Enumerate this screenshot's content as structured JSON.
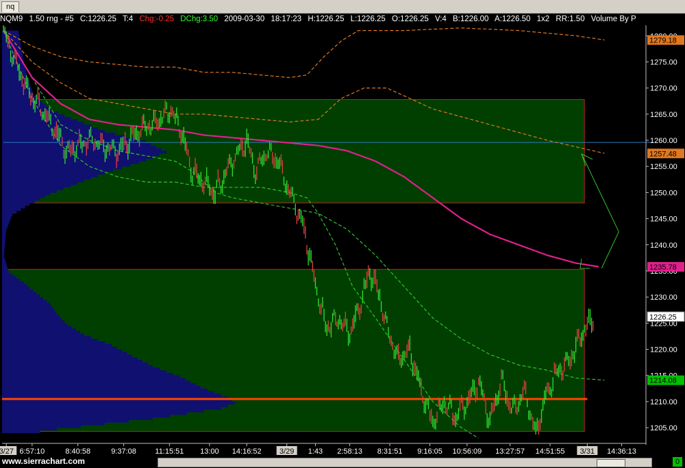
{
  "tab": {
    "label": "nq"
  },
  "header": {
    "symbol": "NQM9",
    "bar_type": "1.50 rng - #5",
    "close": "C:1226.25",
    "ticks": "T:4",
    "chg": "Chg:-0.25",
    "dchg": "DChg:3.50",
    "date": "2009-03-30",
    "time": "18:17:23",
    "high": "H:1226.25",
    "low": "L:1226.25",
    "open": "O:1226.25",
    "volume": "V:4",
    "bid": "B:1226.00",
    "ask": "A:1226.50",
    "size": "1x2",
    "rr": "RR:1.50",
    "study": "Volume By P"
  },
  "footer": {
    "url": "www.sierrachart.com",
    "badge": "0"
  },
  "colors": {
    "background": "#000000",
    "zone": "#003f00",
    "zone_border": "#c02020",
    "profile": "#101070",
    "ma_magenta": "#e0208c",
    "band_orange": "#e07820",
    "band_green": "#30c030",
    "hline_blue": "#2a7cbf",
    "poc_line": "#ff4500",
    "price_up": "#30e030",
    "price_down": "#e04040",
    "arrow": "#30c030"
  },
  "chart_data": {
    "type": "line",
    "title": "",
    "y_axis": {
      "ylim": [
        1202,
        1282
      ],
      "ticks": [
        1280,
        1275,
        1270,
        1265,
        1260,
        1255,
        1250,
        1245,
        1240,
        1235,
        1230,
        1225,
        1220,
        1215,
        1210,
        1205
      ],
      "tick_labels": [
        "1280.00",
        "1275.00",
        "1270.00",
        "1265.00",
        "1260.00",
        "1255.00",
        "1250.00",
        "1245.00",
        "1240.00",
        "1235.00",
        "1230.00",
        "1225.00",
        "1220.00",
        "1215.00",
        "1210.00",
        "1205.00"
      ]
    },
    "x_axis": {
      "ticks": [
        {
          "label": "3/27",
          "bar": 1,
          "is_date": true
        },
        {
          "label": "6:57:10",
          "bar": 10
        },
        {
          "label": "8:40:58",
          "bar": 26
        },
        {
          "label": "9:37:08",
          "bar": 42
        },
        {
          "label": "11:15:51",
          "bar": 58
        },
        {
          "label": "13:00",
          "bar": 72
        },
        {
          "label": "14:16:52",
          "bar": 85
        },
        {
          "label": "3/29",
          "bar": 99,
          "is_date": true
        },
        {
          "label": "1:43",
          "bar": 109
        },
        {
          "label": "2:58:13",
          "bar": 121
        },
        {
          "label": "8:31:51",
          "bar": 135
        },
        {
          "label": "9:16:05",
          "bar": 149
        },
        {
          "label": "10:56:09",
          "bar": 162
        },
        {
          "label": "13:27:57",
          "bar": 177
        },
        {
          "label": "14:51:55",
          "bar": 191
        },
        {
          "label": "3/31",
          "bar": 204,
          "is_date": true
        },
        {
          "label": "14:36:13",
          "bar": 216
        }
      ],
      "bar_count": 225
    },
    "price_series": {
      "name": "NQM9",
      "anchors": [
        [
          0,
          1281
        ],
        [
          4,
          1275
        ],
        [
          8,
          1270
        ],
        [
          12,
          1267
        ],
        [
          18,
          1262
        ],
        [
          22,
          1258
        ],
        [
          30,
          1260
        ],
        [
          40,
          1258
        ],
        [
          48,
          1262
        ],
        [
          55,
          1264
        ],
        [
          58,
          1266
        ],
        [
          62,
          1262
        ],
        [
          66,
          1254
        ],
        [
          70,
          1252
        ],
        [
          74,
          1250
        ],
        [
          80,
          1256
        ],
        [
          85,
          1260
        ],
        [
          88,
          1254
        ],
        [
          92,
          1258
        ],
        [
          96,
          1256
        ],
        [
          100,
          1250
        ],
        [
          104,
          1245
        ],
        [
          107,
          1238
        ],
        [
          110,
          1230
        ],
        [
          113,
          1224
        ],
        [
          117,
          1226
        ],
        [
          121,
          1223
        ],
        [
          125,
          1229
        ],
        [
          128,
          1235
        ],
        [
          131,
          1231
        ],
        [
          134,
          1224
        ],
        [
          138,
          1218
        ],
        [
          142,
          1220
        ],
        [
          146,
          1212
        ],
        [
          150,
          1206
        ],
        [
          154,
          1210
        ],
        [
          158,
          1207
        ],
        [
          162,
          1210
        ],
        [
          166,
          1214
        ],
        [
          170,
          1206
        ],
        [
          174,
          1214
        ],
        [
          178,
          1208
        ],
        [
          182,
          1212
        ],
        [
          186,
          1204
        ],
        [
          190,
          1212
        ],
        [
          194,
          1216
        ],
        [
          198,
          1218
        ],
        [
          202,
          1223
        ],
        [
          206,
          1226.25
        ]
      ]
    },
    "moving_average": {
      "anchors": [
        [
          0,
          1281
        ],
        [
          10,
          1272
        ],
        [
          20,
          1267
        ],
        [
          30,
          1264
        ],
        [
          40,
          1263
        ],
        [
          60,
          1262
        ],
        [
          70,
          1261
        ],
        [
          80,
          1260.5
        ],
        [
          90,
          1260
        ],
        [
          100,
          1259.5
        ],
        [
          110,
          1259
        ],
        [
          120,
          1258
        ],
        [
          130,
          1256
        ],
        [
          140,
          1253
        ],
        [
          150,
          1249
        ],
        [
          160,
          1245
        ],
        [
          170,
          1242
        ],
        [
          180,
          1240
        ],
        [
          190,
          1238
        ],
        [
          200,
          1236.5
        ],
        [
          208,
          1235.8
        ]
      ],
      "last_label": "1235.78"
    },
    "upper_band": {
      "anchors": [
        [
          0,
          1281
        ],
        [
          10,
          1278
        ],
        [
          20,
          1276
        ],
        [
          30,
          1275
        ],
        [
          40,
          1274.5
        ],
        [
          50,
          1274
        ],
        [
          60,
          1274
        ],
        [
          70,
          1273
        ],
        [
          80,
          1273
        ],
        [
          90,
          1272.5
        ],
        [
          100,
          1272
        ],
        [
          106,
          1272.5
        ],
        [
          112,
          1276
        ],
        [
          118,
          1279
        ],
        [
          124,
          1281
        ],
        [
          140,
          1281
        ],
        [
          160,
          1281.5
        ],
        [
          180,
          1281
        ],
        [
          200,
          1280
        ],
        [
          210,
          1279.2
        ]
      ],
      "last_label": "1279.18"
    },
    "upper_inner_band": {
      "anchors": [
        [
          0,
          1281
        ],
        [
          10,
          1275
        ],
        [
          20,
          1271
        ],
        [
          30,
          1268
        ],
        [
          40,
          1267
        ],
        [
          50,
          1266
        ],
        [
          60,
          1265
        ],
        [
          70,
          1265
        ],
        [
          80,
          1264.5
        ],
        [
          90,
          1264
        ],
        [
          100,
          1263.5
        ],
        [
          110,
          1264
        ],
        [
          118,
          1268
        ],
        [
          126,
          1270
        ],
        [
          134,
          1270
        ],
        [
          150,
          1266
        ],
        [
          170,
          1263
        ],
        [
          190,
          1260
        ],
        [
          210,
          1257.5
        ]
      ],
      "last_label": "1257.48"
    },
    "lower_inner_band": {
      "anchors": [
        [
          0,
          1281
        ],
        [
          10,
          1272
        ],
        [
          20,
          1263
        ],
        [
          30,
          1260
        ],
        [
          40,
          1258
        ],
        [
          50,
          1257
        ],
        [
          60,
          1256
        ],
        [
          66,
          1254
        ],
        [
          70,
          1252
        ],
        [
          74,
          1250
        ],
        [
          80,
          1249
        ],
        [
          90,
          1248
        ],
        [
          100,
          1247
        ],
        [
          110,
          1246
        ],
        [
          120,
          1243
        ],
        [
          130,
          1238
        ],
        [
          140,
          1232
        ],
        [
          150,
          1226
        ],
        [
          160,
          1222
        ],
        [
          170,
          1219
        ],
        [
          180,
          1217
        ],
        [
          190,
          1216
        ],
        [
          200,
          1214.5
        ],
        [
          210,
          1214.1
        ]
      ],
      "last_label": "1214.08"
    },
    "lower_band": {
      "anchors": [
        [
          0,
          1281
        ],
        [
          10,
          1268
        ],
        [
          20,
          1259
        ],
        [
          30,
          1255
        ],
        [
          40,
          1253
        ],
        [
          50,
          1252
        ],
        [
          60,
          1252
        ],
        [
          70,
          1251
        ],
        [
          80,
          1251
        ],
        [
          90,
          1251
        ],
        [
          100,
          1250
        ],
        [
          106,
          1249
        ],
        [
          110,
          1246
        ],
        [
          116,
          1240
        ],
        [
          122,
          1232
        ],
        [
          130,
          1226
        ],
        [
          140,
          1218
        ],
        [
          150,
          1210
        ],
        [
          160,
          1205
        ],
        [
          166,
          1203
        ]
      ]
    },
    "value_zones": [
      {
        "high": 1267.8,
        "low": 1248.0
      },
      {
        "high": 1235.3,
        "low": 1204.3
      }
    ],
    "horizontal_lines": [
      {
        "name": "blue-level",
        "value": 1259.6
      },
      {
        "name": "poc-line",
        "value": 1210.5
      }
    ],
    "volume_profile": [
      [
        1281,
        24
      ],
      [
        1278,
        28
      ],
      [
        1275,
        32
      ],
      [
        1272,
        38
      ],
      [
        1269,
        46
      ],
      [
        1266,
        72
      ],
      [
        1264,
        110
      ],
      [
        1262,
        150
      ],
      [
        1260,
        210
      ],
      [
        1258,
        240
      ],
      [
        1256,
        200
      ],
      [
        1254,
        150
      ],
      [
        1252,
        110
      ],
      [
        1250,
        70
      ],
      [
        1248,
        40
      ],
      [
        1246,
        15
      ],
      [
        1243,
        6
      ],
      [
        1240,
        4
      ],
      [
        1238,
        3
      ],
      [
        1235,
        10
      ],
      [
        1233,
        32
      ],
      [
        1231,
        50
      ],
      [
        1229,
        70
      ],
      [
        1227,
        80
      ],
      [
        1225,
        95
      ],
      [
        1223,
        120
      ],
      [
        1221,
        160
      ],
      [
        1219,
        190
      ],
      [
        1217,
        220
      ],
      [
        1215,
        260
      ],
      [
        1213,
        290
      ],
      [
        1211,
        330
      ],
      [
        1210,
        340
      ],
      [
        1209,
        320
      ],
      [
        1208,
        270
      ],
      [
        1207,
        220
      ],
      [
        1206,
        150
      ],
      [
        1205,
        80
      ],
      [
        1204,
        30
      ]
    ],
    "price_labels": [
      {
        "value": 1279.18,
        "text": "1279.18",
        "color": "#e07820"
      },
      {
        "value": 1257.48,
        "text": "1257.48",
        "color": "#e07820"
      },
      {
        "value": 1235.78,
        "text": "1235.78",
        "color": "#e0208c"
      },
      {
        "value": 1226.25,
        "text": "1226.25",
        "color": "#ffffff"
      },
      {
        "value": 1214.08,
        "text": "1214.08",
        "color": "#00c000"
      }
    ],
    "arrows": [
      {
        "from": [
          209,
          1235.5
        ],
        "to": [
          215,
          1242.5
        ],
        "head": false
      },
      {
        "from": [
          215,
          1242.5
        ],
        "to": [
          202,
          1257.4
        ],
        "head": true
      }
    ]
  }
}
